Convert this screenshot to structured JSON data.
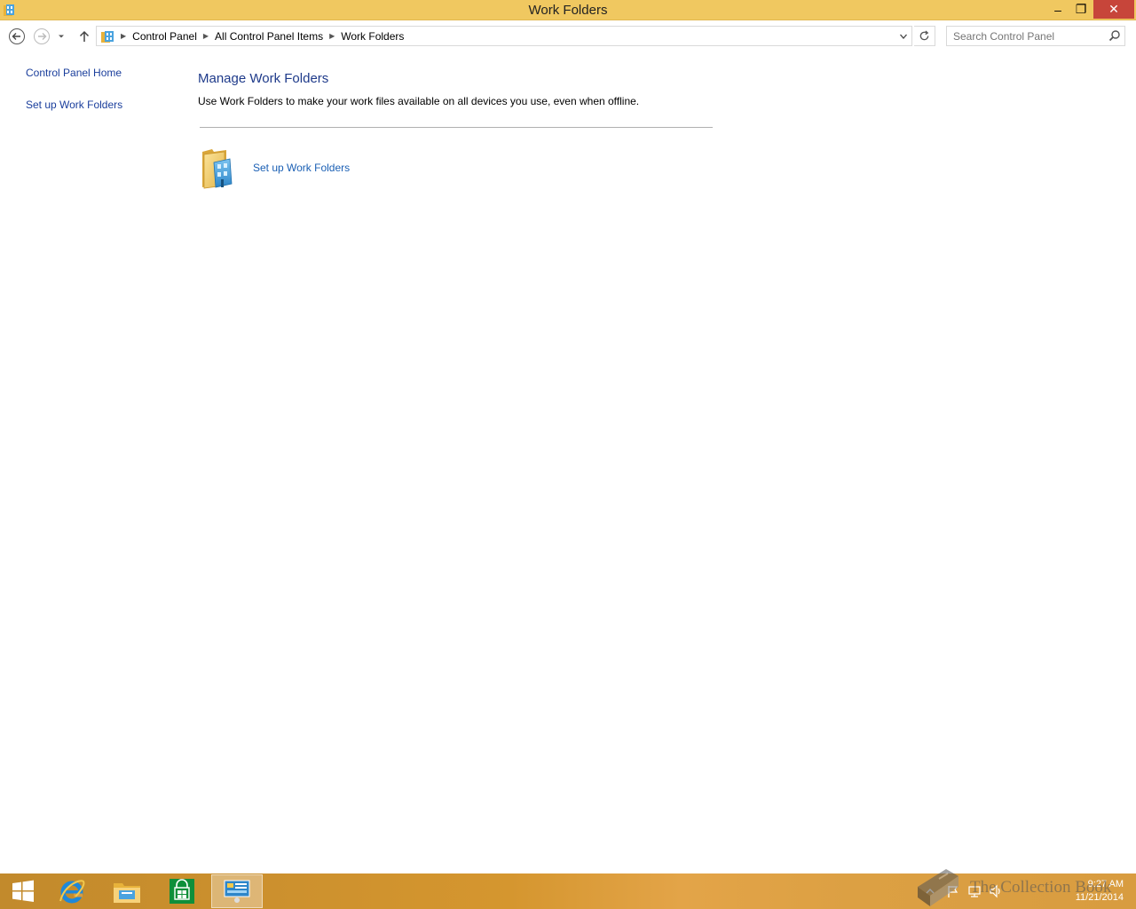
{
  "window": {
    "title": "Work Folders",
    "minimize_glyph": "–",
    "restore_glyph": "❐",
    "close_glyph": "✕"
  },
  "navigation": {
    "breadcrumbs": [
      "Control Panel",
      "All Control Panel Items",
      "Work Folders"
    ],
    "search_placeholder": "Search Control Panel"
  },
  "left_pane": {
    "links": [
      "Control Panel Home",
      "Set up Work Folders"
    ]
  },
  "main": {
    "title": "Manage Work Folders",
    "description": "Use Work Folders to make your work files available on all devices you use, even when offline.",
    "task_link": "Set up Work Folders"
  },
  "taskbar": {
    "apps": [
      "start-icon",
      "internet-explorer-icon",
      "file-explorer-icon",
      "store-icon",
      "control-panel-icon"
    ],
    "clock_time": "9:27 AM",
    "clock_date": "11/21/2014"
  },
  "watermark": {
    "text": "The Collection Book"
  },
  "colors": {
    "titlebar": "#f0c860",
    "close_button": "#c7453a",
    "link": "#1a3e9c",
    "heading": "#1e3a8a"
  }
}
